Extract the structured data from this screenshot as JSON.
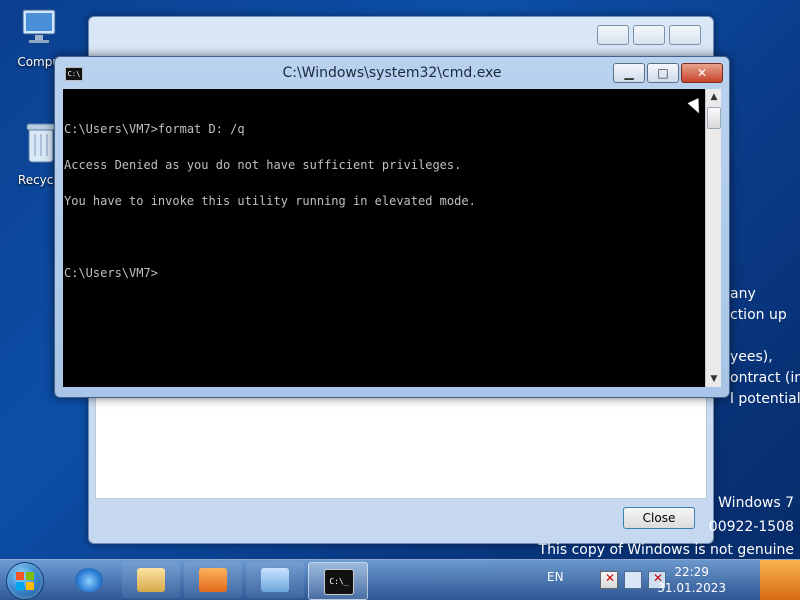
{
  "desktop": {
    "icons": [
      {
        "label": "Comput"
      },
      {
        "label": "Recycle"
      }
    ],
    "side_text": [
      "any",
      "ction up",
      "yees),",
      "ontract (in",
      "l potential"
    ],
    "watermark": {
      "line1": "Windows 7",
      "line2": "00922-1508",
      "line3": "This copy of Windows is not genuine"
    }
  },
  "background_window": {
    "close_button_label": "Close"
  },
  "cmd_window": {
    "title": "C:\\Windows\\system32\\cmd.exe",
    "console_lines": [
      "C:\\Users\\VM7>format D: /q",
      "Access Denied as you do not have sufficient privileges.",
      "You have to invoke this utility running in elevated mode.",
      "",
      "C:\\Users\\VM7>"
    ]
  },
  "taskbar": {
    "language": "EN",
    "clock": {
      "time": "22:29",
      "date": "31.01.2023"
    },
    "pinned_items": [
      "ie-icon",
      "explorer-icon",
      "media-player-icon",
      "control-panel-icon",
      "cmd-icon"
    ]
  },
  "colors": {
    "console_bg": "#000000",
    "console_text": "#c0c0c0",
    "desktop_blue": "#0d4fa8",
    "close_button_red": "#c7442a"
  }
}
